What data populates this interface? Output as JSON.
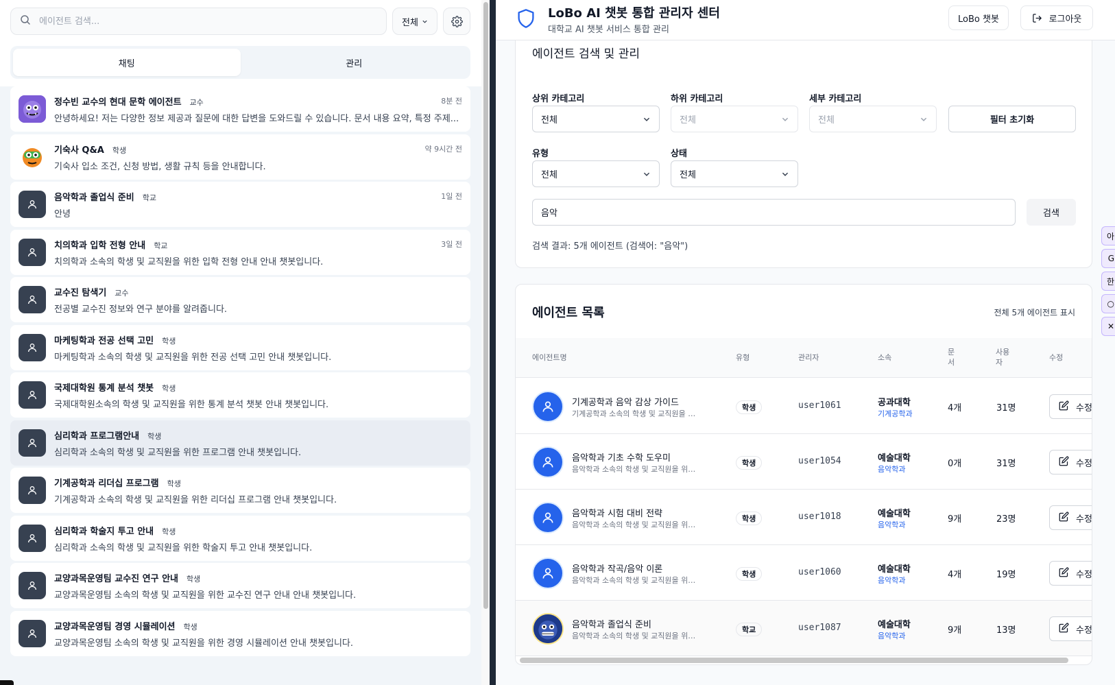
{
  "left": {
    "search_placeholder": "에이전트 검색...",
    "filter_label": "전체",
    "tabs": [
      "채팅",
      "관리"
    ],
    "items": [
      {
        "title": "정수빈 교수의 현대 문학 에이전트",
        "badge": "교수",
        "time": "8분 전",
        "desc": "안녕하세요! 저는 다양한 정보 제공과 질문에 대한 답변을 도와드릴 수 있습니다. 문서 내용 요약, 특정 주제..."
      },
      {
        "title": "기숙사 Q&A",
        "badge": "학생",
        "time": "약 9시간 전",
        "desc": "기숙사 입소 조건, 신청 방법, 생활 규칙 등을 안내합니다."
      },
      {
        "title": "음악학과 졸업식 준비",
        "badge": "학교",
        "time": "1일 전",
        "desc": "안녕"
      },
      {
        "title": "치의학과 입학 전형 안내",
        "badge": "학교",
        "time": "3일 전",
        "desc": "치의학과 소속의 학생 및 교직원을 위한 입학 전형 안내 안내 챗봇입니다."
      },
      {
        "title": "교수진 탐색기",
        "badge": "교수",
        "time": "",
        "desc": "전공별 교수진 정보와 연구 분야를 알려줍니다."
      },
      {
        "title": "마케팅학과 전공 선택 고민",
        "badge": "학생",
        "time": "",
        "desc": "마케팅학과 소속의 학생 및 교직원을 위한 전공 선택 고민 안내 챗봇입니다."
      },
      {
        "title": "국제대학원 통계 분석 챗봇",
        "badge": "학생",
        "time": "",
        "desc": "국제대학원소속의 학생 및 교직원을 위한 통계 분석 챗봇 안내 챗봇입니다."
      },
      {
        "title": "심리학과 프로그램안내",
        "badge": "학생",
        "time": "",
        "desc": "심리학과 소속의 학생 및 교직원을 위한 프로그램 안내 챗봇입니다."
      },
      {
        "title": "기계공학과 리더십 프로그램",
        "badge": "학생",
        "time": "",
        "desc": "기계공학과 소속의 학생 및 교직원을 위한 리더십 프로그램 안내 챗봇입니다."
      },
      {
        "title": "심리학과 학술지 투고 안내",
        "badge": "학생",
        "time": "",
        "desc": "심리학과 소속의 학생 및 교직원을 위한 학술지 투고 안내 챗봇입니다."
      },
      {
        "title": "교양과목운영팀 교수진 연구 안내",
        "badge": "학생",
        "time": "",
        "desc": "교양과목운영팀 소속의 학생 및 교직원을 위한 교수진 연구 안내 안내 챗봇입니다."
      },
      {
        "title": "교양과목운영팀 경영 시뮬레이션",
        "badge": "학생",
        "time": "",
        "desc": "교양과목운영팀 소속의 학생 및 교직원을 위한 경영 시뮬레이션 안내 챗봇입니다."
      }
    ]
  },
  "header": {
    "title": "LoBo AI 챗봇 통합 관리자 센터",
    "subtitle": "대학교 AI 챗봇 서비스 통합 관리",
    "chatbot_btn": "LoBo 챗봇",
    "logout_btn": "로그아웃"
  },
  "search_card": {
    "title": "에이전트 검색 및 관리",
    "labels": {
      "top": "상위 카테고리",
      "sub": "하위 카테고리",
      "detail": "세부 카테고리",
      "type": "유형",
      "status": "상태"
    },
    "values": {
      "top": "전체",
      "sub": "전체",
      "detail": "전체",
      "type": "전체",
      "status": "전체"
    },
    "reset": "필터 초기화",
    "query": "음악",
    "search_btn": "검색",
    "result": "검색 결과: 5개 에이전트 (검색어: \"음악\")"
  },
  "list_card": {
    "title": "에이전트 목록",
    "count": "전체 5개 에이전트 표시",
    "headers": {
      "name": "에이전트명",
      "type": "유형",
      "manager": "관리자",
      "org": "소속",
      "docs_1": "문",
      "docs_2": "서",
      "users_1": "사용",
      "users_2": "자",
      "edit": "수정"
    },
    "edit_label": "수정",
    "rows": [
      {
        "name": "기계공학과 음악 감상 가이드",
        "desc": "기계공학과 소속의 학생 및 교직원을 위한 음악 감상 가이드",
        "type": "학생",
        "user": "user1061",
        "college": "공과대학",
        "dept": "기계공학과",
        "docs": "4개",
        "users": "31명"
      },
      {
        "name": "음악학과 기초 수학 도우미",
        "desc": "음악학과 소속의 학생 및 교직원을 위한 기초 수학 도우미",
        "type": "학생",
        "user": "user1054",
        "college": "예술대학",
        "dept": "음악학과",
        "docs": "0개",
        "users": "31명"
      },
      {
        "name": "음악학과 시험 대비 전략",
        "desc": "음악학과 소속의 학생 및 교직원을 위한 시험 대비 전략",
        "type": "학생",
        "user": "user1018",
        "college": "예술대학",
        "dept": "음악학과",
        "docs": "9개",
        "users": "23명"
      },
      {
        "name": "음악학과 작곡/음악 이론",
        "desc": "음악학과 소속의 학생 및 교직원을 위한 작곡/음악 이론",
        "type": "학생",
        "user": "user1060",
        "college": "예술대학",
        "dept": "음악학과",
        "docs": "4개",
        "users": "19명"
      },
      {
        "name": "음악학과 졸업식 준비",
        "desc": "음악학과 소속의 학생 및 교직원을 위한 졸업식 준비",
        "type": "학교",
        "user": "user1087",
        "college": "예술대학",
        "dept": "음악학과",
        "docs": "9개",
        "users": "13명"
      }
    ]
  },
  "side_tools": [
    "아",
    "G",
    "한",
    "○",
    "✕"
  ]
}
